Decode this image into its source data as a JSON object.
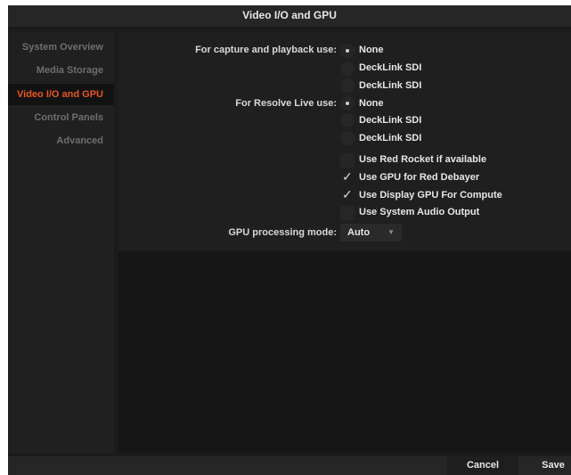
{
  "window": {
    "title": "Video I/O and GPU"
  },
  "sidebar": {
    "items": [
      {
        "label": "System Overview",
        "active": false
      },
      {
        "label": "Media Storage",
        "active": false
      },
      {
        "label": "Video I/O and GPU",
        "active": true
      },
      {
        "label": "Control Panels",
        "active": false
      },
      {
        "label": "Advanced",
        "active": false
      }
    ]
  },
  "settings": {
    "capture": {
      "label": "For capture and playback use:",
      "options": [
        "None",
        "DeckLink SDI",
        "DeckLink SDI"
      ],
      "selected": 0
    },
    "resolve_live": {
      "label": "For Resolve Live use:",
      "options": [
        "None",
        "DeckLink SDI",
        "DeckLink SDI"
      ],
      "selected": 0
    },
    "checkboxes": [
      {
        "label": "Use Red Rocket if available",
        "checked": false
      },
      {
        "label": "Use GPU for Red Debayer",
        "checked": true
      },
      {
        "label": "Use Display GPU For Compute",
        "checked": true
      },
      {
        "label": "Use System Audio Output",
        "checked": false
      }
    ],
    "gpu_mode": {
      "label": "GPU processing mode:",
      "value": "Auto"
    }
  },
  "footer": {
    "cancel_label": "Cancel",
    "save_label": "Save"
  },
  "colors": {
    "accent": "#e8561f",
    "background": "#1b1b1b"
  }
}
